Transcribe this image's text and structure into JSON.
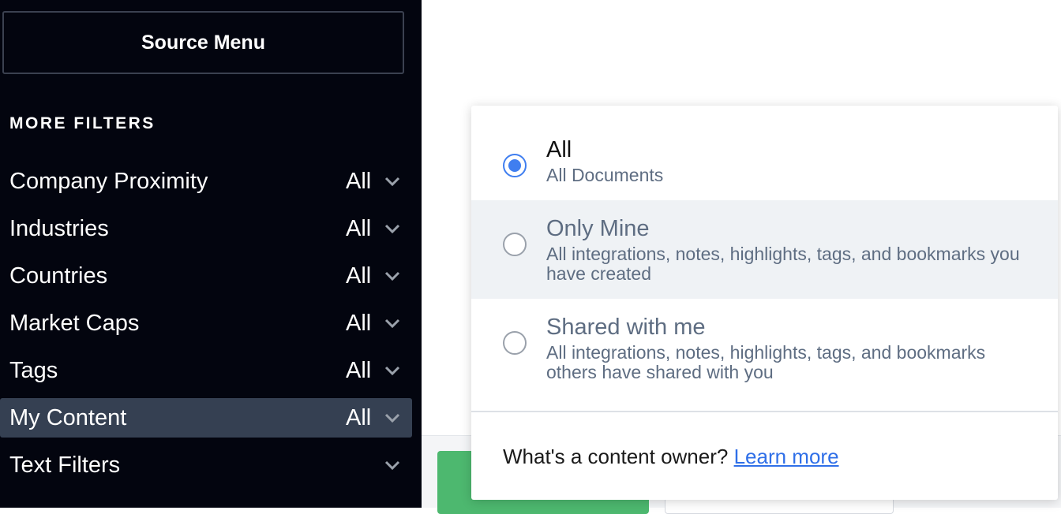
{
  "sidebar": {
    "source_menu_label": "Source Menu",
    "filters_heading": "MORE FILTERS",
    "filters": [
      {
        "label": "Company Proximity",
        "value": "All"
      },
      {
        "label": "Industries",
        "value": "All"
      },
      {
        "label": "Countries",
        "value": "All"
      },
      {
        "label": "Market Caps",
        "value": "All"
      },
      {
        "label": "Tags",
        "value": "All"
      },
      {
        "label": "My Content",
        "value": "All"
      },
      {
        "label": "Text Filters",
        "value": ""
      }
    ]
  },
  "dropdown": {
    "options": [
      {
        "title": "All",
        "description": "All Documents",
        "selected": true
      },
      {
        "title": "Only Mine",
        "description": "All integrations, notes, highlights, tags, and bookmarks you have created",
        "selected": false
      },
      {
        "title": "Shared with me",
        "description": "All integrations, notes, highlights, tags, and bookmarks others have shared with you",
        "selected": false
      }
    ],
    "footer_question": "What's a content owner?",
    "footer_link": "Learn more"
  },
  "colors": {
    "sidebar_bg": "#03050f",
    "active_row_bg": "#354052",
    "accent_blue": "#3f7ef0",
    "link_blue": "#2f6fe8",
    "green_button": "#4db86f"
  }
}
